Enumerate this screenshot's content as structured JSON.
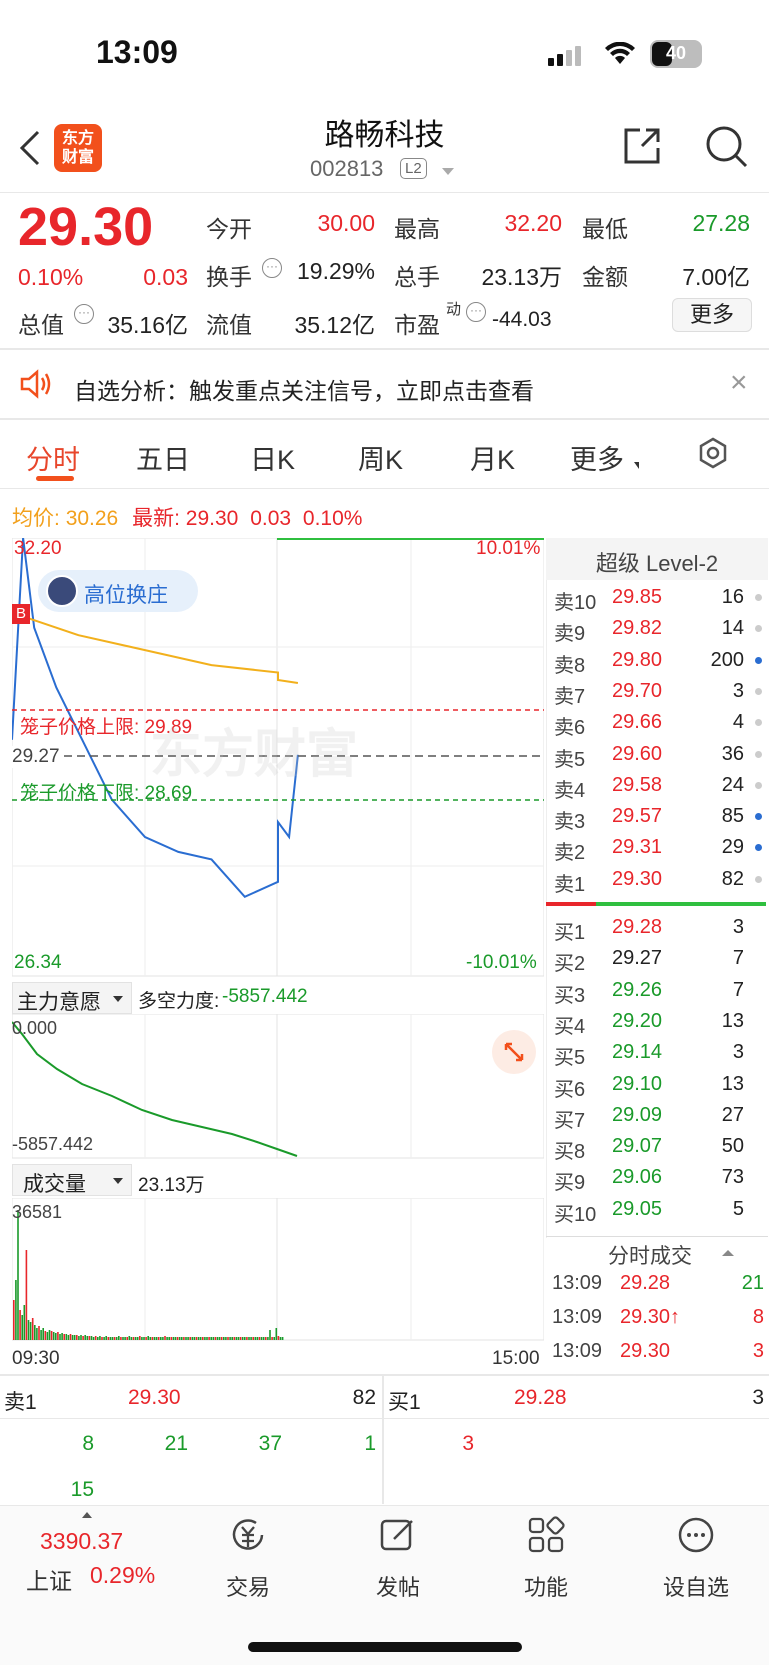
{
  "status_bar": {
    "time": "13:09",
    "battery": "40"
  },
  "header": {
    "stock_name": "路畅科技",
    "stock_code": "002813",
    "level_badge": "L2",
    "logo_text": "东方财富"
  },
  "quote": {
    "price": "29.30",
    "change_pct": "0.10%",
    "change": "0.03",
    "labels": {
      "open": "今开",
      "high": "最高",
      "low": "最低",
      "turnover": "换手",
      "volume": "总手",
      "amount": "金额",
      "total_value": "总值",
      "float_value": "流值",
      "pe": "市盈"
    },
    "open": "30.00",
    "high": "32.20",
    "low": "27.28",
    "turnover": "19.29%",
    "volume": "23.13万",
    "amount": "7.00亿",
    "total_value": "35.16亿",
    "float_value": "35.12亿",
    "pe_sup": "动",
    "pe": "-44.03",
    "more_button": "更多"
  },
  "notice": {
    "text": "自选分析：触发重点关注信号，立即点击查看",
    "close": "×"
  },
  "tabs": [
    "分时",
    "五日",
    "日K",
    "周K",
    "月K",
    "更多"
  ],
  "avg_line": {
    "avg_label": "均价:",
    "avg_value": "30.26",
    "last_label": "最新:",
    "last_value": "29.30",
    "change": "0.03",
    "change_pct": "0.10%"
  },
  "chart": {
    "high_label": "32.20",
    "low_label": "26.34",
    "mid_label": "29.27",
    "up_pct": "10.01%",
    "down_pct": "-10.01%",
    "upper_limit_label": "笼子价格上限: 29.89",
    "lower_limit_label": "笼子价格下限: 28.69",
    "badge_text": "高位换庄",
    "buy_marker": "B",
    "watermark": "东方财富",
    "time_start": "09:30",
    "time_end": "15:00"
  },
  "chart_data": {
    "type": "line",
    "title": "",
    "series": [
      {
        "name": "",
        "x": [
          "09:30",
          "09:35",
          "09:40",
          "09:50",
          "10:00",
          "10:15",
          "10:30",
          "10:45",
          "11:00",
          "11:15",
          "11:30",
          "13:00",
          "13:05",
          "13:09"
        ],
        "values": [
          29.5,
          32.2,
          31.0,
          30.2,
          29.6,
          28.7,
          28.2,
          28.0,
          27.9,
          27.4,
          27.6,
          28.4,
          28.2,
          29.3
        ]
      },
      {
        "name": "",
        "x": [
          "09:30",
          "10:00",
          "10:30",
          "11:00",
          "11:30",
          "13:00",
          "13:09"
        ],
        "values": [
          31.2,
          30.9,
          30.7,
          30.5,
          30.4,
          30.3,
          30.26
        ]
      }
    ],
    "ylim": [
      26.34,
      32.2
    ],
    "xlim": [
      "09:30",
      "15:00"
    ]
  },
  "indicator": {
    "label": "主力意愿",
    "text": "多空力度:",
    "value": "-5857.442",
    "top_label": "0.000",
    "bottom_label": "-5857.442"
  },
  "volume": {
    "label": "成交量",
    "value": "23.13万",
    "max_label": "36581"
  },
  "orderbook": {
    "title": "超级 Level-2",
    "asks": [
      {
        "label": "卖10",
        "price": "29.85",
        "vol": "16",
        "dot": "grey"
      },
      {
        "label": "卖9",
        "price": "29.82",
        "vol": "14",
        "dot": "grey"
      },
      {
        "label": "卖8",
        "price": "29.80",
        "vol": "200",
        "dot": "blue"
      },
      {
        "label": "卖7",
        "price": "29.70",
        "vol": "3",
        "dot": "grey"
      },
      {
        "label": "卖6",
        "price": "29.66",
        "vol": "4",
        "dot": "grey"
      },
      {
        "label": "卖5",
        "price": "29.60",
        "vol": "36",
        "dot": "grey"
      },
      {
        "label": "卖4",
        "price": "29.58",
        "vol": "24",
        "dot": "grey"
      },
      {
        "label": "卖3",
        "price": "29.57",
        "vol": "85",
        "dot": "blue"
      },
      {
        "label": "卖2",
        "price": "29.31",
        "vol": "29",
        "dot": "blue"
      },
      {
        "label": "卖1",
        "price": "29.30",
        "vol": "82",
        "dot": "grey"
      }
    ],
    "bids": [
      {
        "label": "买1",
        "price": "29.28",
        "vol": "3"
      },
      {
        "label": "买2",
        "price": "29.27",
        "vol": "7"
      },
      {
        "label": "买3",
        "price": "29.26",
        "vol": "7"
      },
      {
        "label": "买4",
        "price": "29.20",
        "vol": "13"
      },
      {
        "label": "买5",
        "price": "29.14",
        "vol": "3"
      },
      {
        "label": "买6",
        "price": "29.10",
        "vol": "13"
      },
      {
        "label": "买7",
        "price": "29.09",
        "vol": "27"
      },
      {
        "label": "买8",
        "price": "29.07",
        "vol": "50"
      },
      {
        "label": "买9",
        "price": "29.06",
        "vol": "73"
      },
      {
        "label": "买10",
        "price": "29.05",
        "vol": "5"
      }
    ],
    "ticks_title": "分时成交",
    "ticks": [
      {
        "time": "13:09",
        "price": "29.28",
        "vol": "21"
      },
      {
        "time": "13:09",
        "price": "29.30↑",
        "vol": "8"
      },
      {
        "time": "13:09",
        "price": "29.30",
        "vol": "3"
      }
    ]
  },
  "queue": {
    "sell_label": "卖1",
    "sell_price": "29.30",
    "sell_vol": "82",
    "buy_label": "买1",
    "buy_price": "29.28",
    "buy_vol": "3",
    "sell_orders": [
      "8",
      "21",
      "37",
      "1",
      "15"
    ],
    "buy_orders": [
      "3"
    ]
  },
  "bottom_nav": {
    "index_value": "3390.37",
    "index_name": "上证",
    "index_pct": "0.29%",
    "items": [
      "交易",
      "发帖",
      "功能",
      "设自选"
    ]
  }
}
